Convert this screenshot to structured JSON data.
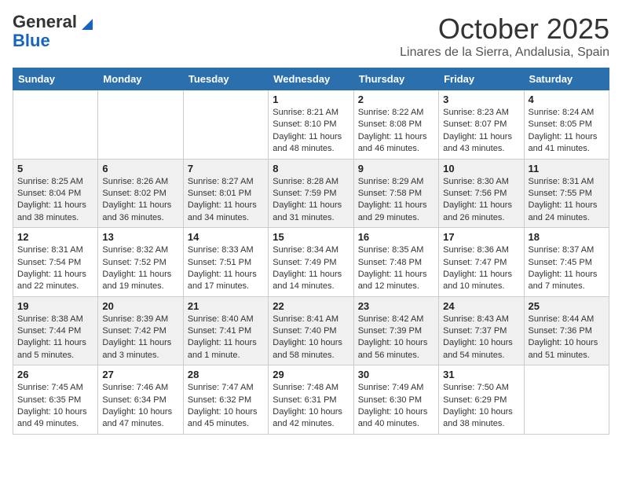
{
  "header": {
    "logo_line1": "General",
    "logo_line2": "Blue",
    "month": "October 2025",
    "location": "Linares de la Sierra, Andalusia, Spain"
  },
  "weekdays": [
    "Sunday",
    "Monday",
    "Tuesday",
    "Wednesday",
    "Thursday",
    "Friday",
    "Saturday"
  ],
  "weeks": [
    [
      {
        "day": "",
        "info": ""
      },
      {
        "day": "",
        "info": ""
      },
      {
        "day": "",
        "info": ""
      },
      {
        "day": "1",
        "info": "Sunrise: 8:21 AM\nSunset: 8:10 PM\nDaylight: 11 hours and 48 minutes."
      },
      {
        "day": "2",
        "info": "Sunrise: 8:22 AM\nSunset: 8:08 PM\nDaylight: 11 hours and 46 minutes."
      },
      {
        "day": "3",
        "info": "Sunrise: 8:23 AM\nSunset: 8:07 PM\nDaylight: 11 hours and 43 minutes."
      },
      {
        "day": "4",
        "info": "Sunrise: 8:24 AM\nSunset: 8:05 PM\nDaylight: 11 hours and 41 minutes."
      }
    ],
    [
      {
        "day": "5",
        "info": "Sunrise: 8:25 AM\nSunset: 8:04 PM\nDaylight: 11 hours and 38 minutes."
      },
      {
        "day": "6",
        "info": "Sunrise: 8:26 AM\nSunset: 8:02 PM\nDaylight: 11 hours and 36 minutes."
      },
      {
        "day": "7",
        "info": "Sunrise: 8:27 AM\nSunset: 8:01 PM\nDaylight: 11 hours and 34 minutes."
      },
      {
        "day": "8",
        "info": "Sunrise: 8:28 AM\nSunset: 7:59 PM\nDaylight: 11 hours and 31 minutes."
      },
      {
        "day": "9",
        "info": "Sunrise: 8:29 AM\nSunset: 7:58 PM\nDaylight: 11 hours and 29 minutes."
      },
      {
        "day": "10",
        "info": "Sunrise: 8:30 AM\nSunset: 7:56 PM\nDaylight: 11 hours and 26 minutes."
      },
      {
        "day": "11",
        "info": "Sunrise: 8:31 AM\nSunset: 7:55 PM\nDaylight: 11 hours and 24 minutes."
      }
    ],
    [
      {
        "day": "12",
        "info": "Sunrise: 8:31 AM\nSunset: 7:54 PM\nDaylight: 11 hours and 22 minutes."
      },
      {
        "day": "13",
        "info": "Sunrise: 8:32 AM\nSunset: 7:52 PM\nDaylight: 11 hours and 19 minutes."
      },
      {
        "day": "14",
        "info": "Sunrise: 8:33 AM\nSunset: 7:51 PM\nDaylight: 11 hours and 17 minutes."
      },
      {
        "day": "15",
        "info": "Sunrise: 8:34 AM\nSunset: 7:49 PM\nDaylight: 11 hours and 14 minutes."
      },
      {
        "day": "16",
        "info": "Sunrise: 8:35 AM\nSunset: 7:48 PM\nDaylight: 11 hours and 12 minutes."
      },
      {
        "day": "17",
        "info": "Sunrise: 8:36 AM\nSunset: 7:47 PM\nDaylight: 11 hours and 10 minutes."
      },
      {
        "day": "18",
        "info": "Sunrise: 8:37 AM\nSunset: 7:45 PM\nDaylight: 11 hours and 7 minutes."
      }
    ],
    [
      {
        "day": "19",
        "info": "Sunrise: 8:38 AM\nSunset: 7:44 PM\nDaylight: 11 hours and 5 minutes."
      },
      {
        "day": "20",
        "info": "Sunrise: 8:39 AM\nSunset: 7:42 PM\nDaylight: 11 hours and 3 minutes."
      },
      {
        "day": "21",
        "info": "Sunrise: 8:40 AM\nSunset: 7:41 PM\nDaylight: 11 hours and 1 minute."
      },
      {
        "day": "22",
        "info": "Sunrise: 8:41 AM\nSunset: 7:40 PM\nDaylight: 10 hours and 58 minutes."
      },
      {
        "day": "23",
        "info": "Sunrise: 8:42 AM\nSunset: 7:39 PM\nDaylight: 10 hours and 56 minutes."
      },
      {
        "day": "24",
        "info": "Sunrise: 8:43 AM\nSunset: 7:37 PM\nDaylight: 10 hours and 54 minutes."
      },
      {
        "day": "25",
        "info": "Sunrise: 8:44 AM\nSunset: 7:36 PM\nDaylight: 10 hours and 51 minutes."
      }
    ],
    [
      {
        "day": "26",
        "info": "Sunrise: 7:45 AM\nSunset: 6:35 PM\nDaylight: 10 hours and 49 minutes."
      },
      {
        "day": "27",
        "info": "Sunrise: 7:46 AM\nSunset: 6:34 PM\nDaylight: 10 hours and 47 minutes."
      },
      {
        "day": "28",
        "info": "Sunrise: 7:47 AM\nSunset: 6:32 PM\nDaylight: 10 hours and 45 minutes."
      },
      {
        "day": "29",
        "info": "Sunrise: 7:48 AM\nSunset: 6:31 PM\nDaylight: 10 hours and 42 minutes."
      },
      {
        "day": "30",
        "info": "Sunrise: 7:49 AM\nSunset: 6:30 PM\nDaylight: 10 hours and 40 minutes."
      },
      {
        "day": "31",
        "info": "Sunrise: 7:50 AM\nSunset: 6:29 PM\nDaylight: 10 hours and 38 minutes."
      },
      {
        "day": "",
        "info": ""
      }
    ]
  ]
}
